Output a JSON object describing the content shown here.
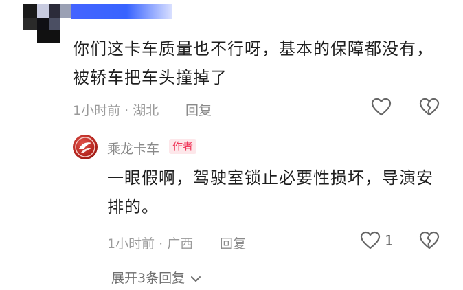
{
  "comment": {
    "text_line1": "你们这卡车质量也不行呀，基本的保障都没有，",
    "text_line2": "被轿车把车头撞掉了",
    "time": "1小时前",
    "location": "湖北",
    "reply_label": "回复",
    "like_icon": "heart-outline-icon",
    "dislike_icon": "broken-heart-icon"
  },
  "reply": {
    "author": "乘龙卡车",
    "badge": "作者",
    "text_line1": "一眼假啊，驾驶室锁止必要性损坏，导演安",
    "text_line2": "排的。",
    "time": "1小时前",
    "location": "广西",
    "reply_label": "回复",
    "like_count": "1",
    "like_icon": "heart-outline-icon",
    "dislike_icon": "broken-heart-icon",
    "avatar_icon": "chenglong-logo-icon"
  },
  "expand": {
    "label": "展开3条回复",
    "icon": "chevron-down-icon"
  },
  "colors": {
    "badge_text": "#f0375a",
    "badge_bg": "#fde7ea",
    "meta_gray": "#9a9a9a",
    "avatar_red": "#b3231c"
  }
}
